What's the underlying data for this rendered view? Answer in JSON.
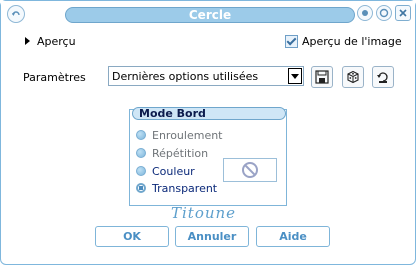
{
  "window": {
    "title": "Cercle"
  },
  "preview": {
    "label": "Aperçu"
  },
  "preview_image": {
    "label": "Aperçu de l'image",
    "checked": true
  },
  "params": {
    "label": "Paramètres",
    "combo_value": "Dernières options utilisées"
  },
  "group": {
    "title": "Mode Bord",
    "options": [
      {
        "label": "Enroulement",
        "selected": false,
        "enabled": false
      },
      {
        "label": "Répétition",
        "selected": false,
        "enabled": false
      },
      {
        "label": "Couleur",
        "selected": false,
        "enabled": true
      },
      {
        "label": "Transparent",
        "selected": true,
        "enabled": true
      }
    ]
  },
  "signature": "Titoune",
  "buttons": {
    "ok": "OK",
    "cancel": "Annuler",
    "help": "Aide"
  },
  "colors": {
    "accent": "#9ccbe9",
    "border": "#7fb5d9",
    "button_text": "#4a8fc4",
    "option_selected_text": "#0c2a7a"
  },
  "icons": {
    "app": "back-arrow-icon",
    "titlebar": [
      "circle-icon",
      "help-icon",
      "close-icon"
    ],
    "toolbar": [
      "save-icon",
      "dice-icon",
      "reset-icon"
    ],
    "swatch": "no-color-icon"
  }
}
